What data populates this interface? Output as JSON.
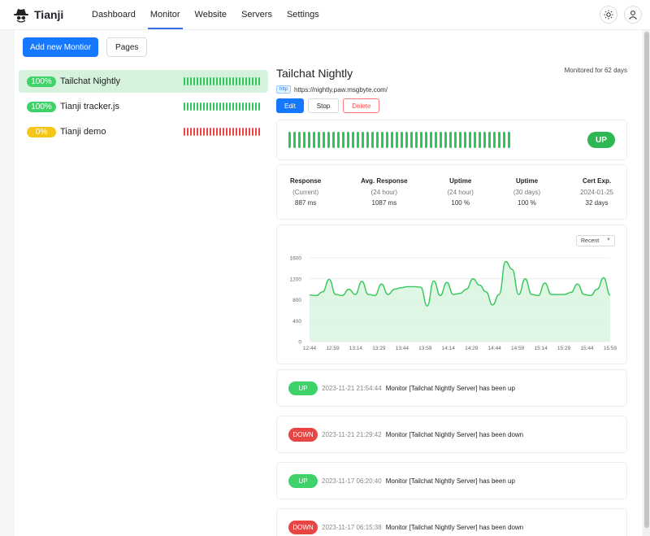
{
  "app": {
    "name": "Tianji"
  },
  "nav": [
    {
      "label": "Dashboard",
      "active": false
    },
    {
      "label": "Monitor",
      "active": true
    },
    {
      "label": "Website",
      "active": false
    },
    {
      "label": "Servers",
      "active": false
    },
    {
      "label": "Settings",
      "active": false
    }
  ],
  "header_icons": [
    "sun-icon",
    "user-icon"
  ],
  "toolbar": {
    "add_label": "Add new Montior",
    "pages_label": "Pages"
  },
  "monitors": [
    {
      "pct": "100%",
      "name": "Tailchat Nightly",
      "status": "green",
      "selected": true
    },
    {
      "pct": "100%",
      "name": "Tianji tracker.js",
      "status": "green",
      "selected": false
    },
    {
      "pct": "0%",
      "name": "Tianji demo",
      "status": "red",
      "selected": false
    }
  ],
  "detail": {
    "title": "Tailchat Nightly",
    "monitored": "Monitored for 62 days",
    "tag": "http",
    "url": "https://nightly.paw.msgbyte.com/",
    "edit_label": "Edit",
    "stop_label": "Stop",
    "delete_label": "Delete",
    "status_badge": "UP"
  },
  "stats": [
    {
      "label": "Response",
      "sub": "(Current)",
      "value": "887 ms"
    },
    {
      "label": "Avg. Response",
      "sub": "(24 hour)",
      "value": "1087 ms"
    },
    {
      "label": "Uptime",
      "sub": "(24 hour)",
      "value": "100 %"
    },
    {
      "label": "Uptime",
      "sub": "(30 days)",
      "value": "100 %"
    },
    {
      "label": "Cert Exp.",
      "sub": "2024-01-25",
      "value": "32 days"
    }
  ],
  "range_select": {
    "value": "Recent"
  },
  "colors": {
    "accent": "#1677ff",
    "up": "#2fc55b",
    "down": "#e84545",
    "warn": "#f5c518"
  },
  "chart_data": {
    "type": "area",
    "x_ticks": [
      "12:44",
      "12:59",
      "13:14",
      "13:29",
      "13:44",
      "13:59",
      "14:14",
      "14:29",
      "14:44",
      "14:59",
      "15:14",
      "15:29",
      "15:44",
      "15:59"
    ],
    "y_ticks": [
      0,
      400,
      800,
      1200,
      1600
    ],
    "ylim": [
      0,
      1600
    ],
    "x_range": [
      "12:44",
      "15:59"
    ],
    "grid": true,
    "series": [
      {
        "values": [
          890,
          880,
          950,
          1190,
          900,
          880,
          1000,
          900,
          1150,
          900,
          880,
          1100,
          900,
          1000,
          1030,
          1050,
          1050,
          1040,
          680,
          1160,
          880,
          1130,
          900,
          920,
          1000,
          1200,
          1080,
          950,
          700,
          900,
          1530,
          1380,
          900,
          1200,
          900,
          880,
          1120,
          900,
          900,
          900,
          940,
          1100,
          900,
          880,
          1000,
          1220,
          890
        ]
      }
    ]
  },
  "events": [
    {
      "status": "UP",
      "time": "2023-11-21 21:54:44",
      "message": "Monitor [Tailchat Nightly Server] has been up"
    },
    {
      "status": "DOWN",
      "time": "2023-11-21 21:29:42",
      "message": "Monitor [Tailchat Nightly Server] has been down"
    },
    {
      "status": "UP",
      "time": "2023-11-17 06:20:40",
      "message": "Monitor [Tailchat Nightly Server] has been up"
    },
    {
      "status": "DOWN",
      "time": "2023-11-17 06:15:38",
      "message": "Monitor [Tailchat Nightly Server] has been down"
    }
  ]
}
